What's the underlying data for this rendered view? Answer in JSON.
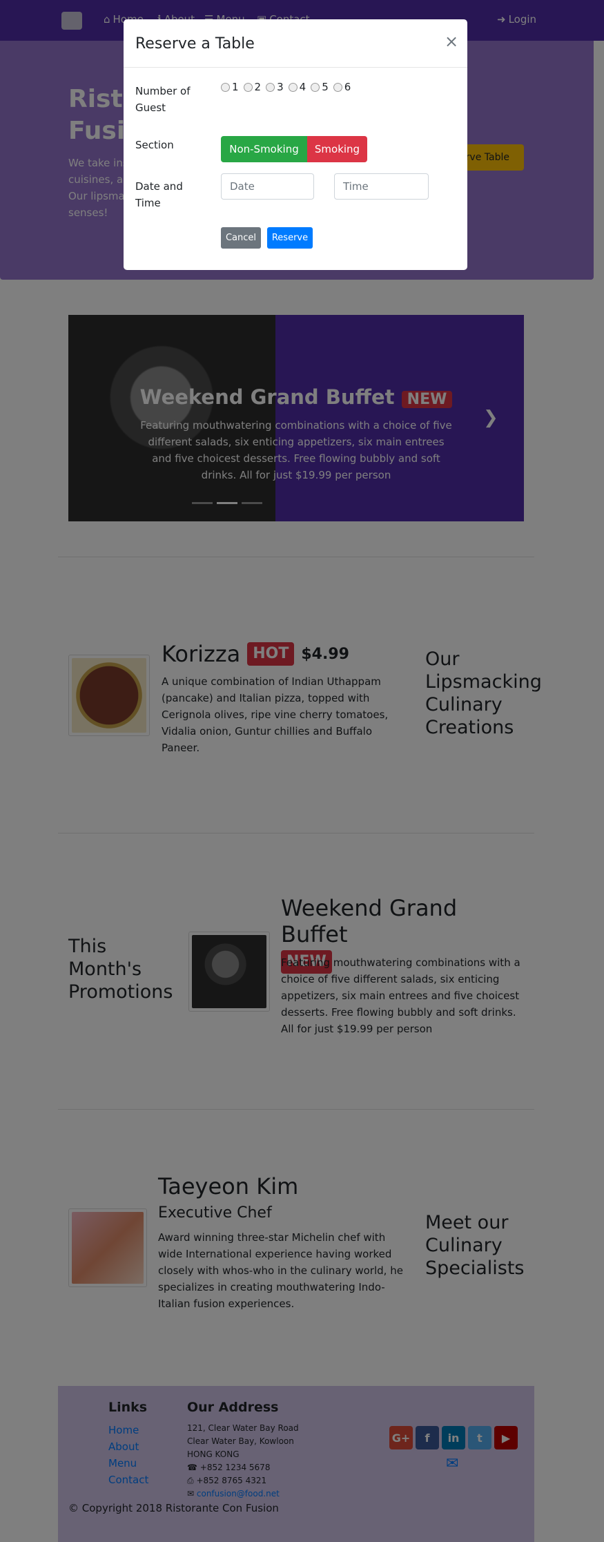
{
  "nav": {
    "items": [
      {
        "label": "Home",
        "icon": "home-icon"
      },
      {
        "label": "About",
        "icon": "info-icon"
      },
      {
        "label": "Menu",
        "icon": "list-icon"
      },
      {
        "label": "Contact",
        "icon": "address-card-icon"
      }
    ],
    "login_label": "Login"
  },
  "jumbotron": {
    "title_line1": "Ristorante con",
    "title_line2": "Fusion",
    "description": "We take inspiration from the World's best cuisines, and create a unique fusion experience. Our lipsmacking creations will tickle your culinary senses!",
    "reserve_label": "Reserve Table"
  },
  "carousel": {
    "title": "Weekend Grand Buffet",
    "badge": "NEW",
    "description": "Featuring mouthwatering combinations with a choice of five different salads, six enticing appetizers, six main entrees and five choicest desserts. Free flowing bubbly and soft drinks. All for just $19.99 per person"
  },
  "dish": {
    "name": "Korizza",
    "badge": "HOT",
    "price": "$4.99",
    "description": "A unique combination of Indian Uthappam (pancake) and Italian pizza, topped with Cerignola olives, ripe vine cherry tomatoes, Vidalia onion, Guntur chillies and Buffalo Paneer.",
    "side_heading": "Our Lipsmacking Culinary Creations"
  },
  "promotion": {
    "side_heading": "This Month's Promotions",
    "name": "Weekend Grand Buffet",
    "badge": "NEW",
    "description": "Featuring mouthwatering combinations with a choice of five different salads, six enticing appetizers, six main entrees and five choicest desserts. Free flowing bubbly and soft drinks. All for just $19.99 per person"
  },
  "leader": {
    "name": "Taeyeon Kim",
    "designation": "Executive Chef",
    "description": "Award winning three-star Michelin chef with wide International experience having worked closely with whos-who in the culinary world, he specializes in creating mouthwatering Indo-Italian fusion experiences.",
    "side_heading": "Meet our Culinary Specialists"
  },
  "footer": {
    "links_title": "Links",
    "links": [
      "Home",
      "About",
      "Menu",
      "Contact"
    ],
    "address_title": "Our Address",
    "address_lines": [
      "121, Clear Water Bay Road",
      "Clear Water Bay, Kowloon",
      "HONG KONG"
    ],
    "phone": "+852 1234 5678",
    "fax": "+852 8765 4321",
    "email": "confusion@food.net",
    "copyright": "© Copyright 2018 Ristorante Con Fusion",
    "social": [
      {
        "icon": "google-plus-icon",
        "glyph": "G+",
        "color": "#dd4b39"
      },
      {
        "icon": "facebook-icon",
        "glyph": "f",
        "color": "#3b5998"
      },
      {
        "icon": "linkedin-icon",
        "glyph": "in",
        "color": "#007bb6"
      },
      {
        "icon": "twitter-icon",
        "glyph": "t",
        "color": "#55acee"
      },
      {
        "icon": "youtube-icon",
        "glyph": "▶",
        "color": "#bb0000"
      }
    ]
  },
  "modal": {
    "title": "Reserve a Table",
    "close": "×",
    "guests_label": "Number of Guest",
    "guest_options": [
      "1",
      "2",
      "3",
      "4",
      "5",
      "6"
    ],
    "section_label": "Section",
    "non_smoking": "Non-Smoking",
    "smoking": "Smoking",
    "datetime_label": "Date and Time",
    "date_placeholder": "Date",
    "time_placeholder": "Time",
    "cancel": "Cancel",
    "reserve": "Reserve"
  },
  "colors": {
    "primary_dark": "#512da8",
    "primary_light": "#9575cd",
    "footer_bg": "#d1c4e9",
    "danger": "#dc3545",
    "success": "#28a745",
    "secondary": "#6c757d",
    "blue": "#007bff",
    "warning": "#ffc107"
  }
}
